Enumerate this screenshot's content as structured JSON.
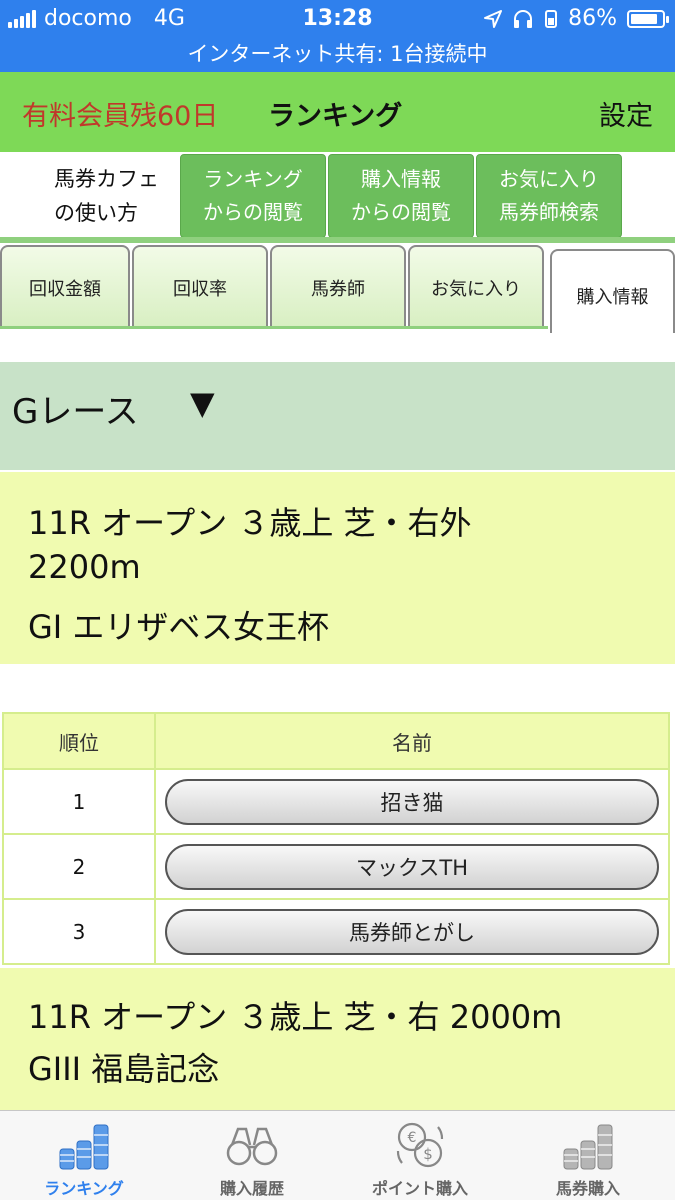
{
  "status_bar": {
    "carrier": "docomo",
    "network": "4G",
    "time": "13:28",
    "battery": "86%",
    "battery_level": 0.86,
    "tethering": "インターネット共有: 1台接続中"
  },
  "header": {
    "member_status": "有料会員残60日",
    "title": "ランキング",
    "settings": "設定"
  },
  "subnav": {
    "guide_line1": "馬券カフェ",
    "guide_line2": "の使い方",
    "buttons": [
      {
        "line1": "ランキング",
        "line2": "からの閲覧"
      },
      {
        "line1": "購入情報",
        "line2": "からの閲覧"
      },
      {
        "line1": "お気に入り",
        "line2": "馬券師検索"
      }
    ]
  },
  "tabs": [
    "回収金額",
    "回収率",
    "馬券師",
    "お気に入り",
    "購入情報"
  ],
  "active_tab": "購入情報",
  "section": {
    "title": "Gレース",
    "arrow": "▼"
  },
  "races": [
    {
      "lines": [
        "11R オープン ３歳上 芝・右外",
        "2200m",
        "GI エリザベス女王杯"
      ]
    },
    {
      "lines": [
        "11R オープン ３歳上 芝・右 2000m",
        "GIII 福島記念"
      ]
    }
  ],
  "table": {
    "headers": {
      "rank": "順位",
      "name": "名前"
    },
    "rows": [
      {
        "rank": "1",
        "name": "招き猫"
      },
      {
        "rank": "2",
        "name": "マックスTH"
      },
      {
        "rank": "3",
        "name": "馬券師とがし"
      }
    ]
  },
  "bottom_nav": [
    {
      "label": "ランキング",
      "icon": "coin-stacks-icon",
      "active": true
    },
    {
      "label": "購入履歴",
      "icon": "binoculars-icon",
      "active": false
    },
    {
      "label": "ポイント購入",
      "icon": "currency-exchange-icon",
      "active": false
    },
    {
      "label": "馬券購入",
      "icon": "coin-stacks-icon",
      "active": false
    }
  ],
  "colors": {
    "status_bar": "#2f80ed",
    "header": "#7ed957",
    "nav_button": "#6cbe5c",
    "member_text": "#c0392b",
    "section_header": "#c8e2c8",
    "race_bg": "#f0fbb0",
    "active_nav": "#2f80ed"
  }
}
